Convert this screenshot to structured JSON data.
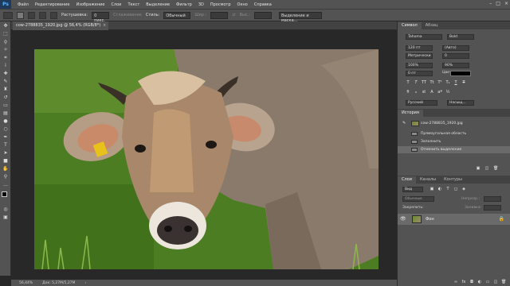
{
  "app": {
    "logo": "Ps"
  },
  "menu": [
    "Файл",
    "Редактирование",
    "Изображение",
    "Слои",
    "Текст",
    "Выделение",
    "Фильтр",
    "3D",
    "Просмотр",
    "Окно",
    "Справка"
  ],
  "options_bar": {
    "feather_label": "Растушевка:",
    "feather_value": "0 пикс.",
    "antialias_label": "Сглаживание",
    "style_label": "Стиль:",
    "style_value": "Обычный",
    "width_label": "Шир.:",
    "height_label": "Выс.:",
    "refine_button": "Выделение и маска..."
  },
  "document": {
    "tab_title": "cow-2788835_1920.jpg @ 56,4% (RGB/8*)",
    "zoom": "56,44%",
    "doc_info": "Док: 5,27M/5,27M"
  },
  "character_panel": {
    "tab_active": "Символ",
    "tab_other": "Абзац",
    "font_family": "Tahoma",
    "font_style": "Bold",
    "size": "120 пт",
    "leading": "(Авто)",
    "kerning": "Метрически",
    "tracking": "0",
    "vscale": "100%",
    "hscale": "90%",
    "baseline": "0 пт",
    "color_label": "Цвет:",
    "language": "Русский",
    "antialias": "Насыщ..."
  },
  "history_panel": {
    "title": "История",
    "snapshot": "cow-2788835_1920.jpg",
    "items": [
      "Прямоугольная область",
      "Заполнить",
      "Отменить выделение"
    ]
  },
  "layers_panel": {
    "tabs": [
      "Слои",
      "Каналы",
      "Контуры"
    ],
    "kind": "Вид",
    "blend_mode": "Обычные",
    "opacity_label": "Непрозр.:",
    "lock_label": "Закрепить:",
    "fill_label": "Заливка:",
    "layer_name": "Фон"
  },
  "colors": {
    "panel_bg": "#535353",
    "canvas_bg": "#282828",
    "selection": "#6a6a6a",
    "grass": "#4e7a22"
  },
  "icons": [
    "move-icon",
    "marquee-icon",
    "lasso-icon",
    "magic-wand-icon",
    "crop-icon",
    "eyedropper-icon",
    "healing-icon",
    "brush-icon",
    "stamp-icon",
    "history-brush-icon",
    "eraser-icon",
    "gradient-icon",
    "blur-icon",
    "dodge-icon",
    "pen-icon",
    "type-icon",
    "path-select-icon",
    "shape-icon",
    "hand-icon",
    "zoom-icon",
    "eye-icon",
    "lock-icon"
  ]
}
